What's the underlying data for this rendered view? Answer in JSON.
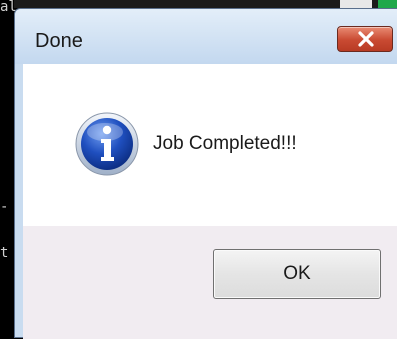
{
  "background": {
    "fragment_top": "al",
    "fragment_mid": "-",
    "fragment_bottom": "t"
  },
  "dialog": {
    "title": "Done",
    "close_icon": "close-icon",
    "icon": "info-icon",
    "message": "Job Completed!!!",
    "ok_label": "OK",
    "colors": {
      "titlebar": "#c9dcf0",
      "close_button": "#c94a32",
      "footer": "#f1ecf1",
      "icon_blue": "#1f4fbf"
    }
  }
}
